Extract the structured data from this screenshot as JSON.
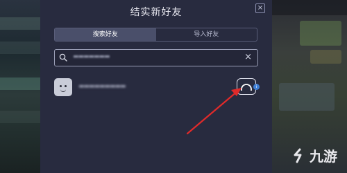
{
  "dialog": {
    "title": "结实新好友",
    "close_symbol": "×"
  },
  "tabs": [
    {
      "label": "搜索好友",
      "active": true
    },
    {
      "label": "导入好友",
      "active": false
    }
  ],
  "search": {
    "value": "▬▬▬▬▬▬▬",
    "clear_symbol": "×"
  },
  "result": {
    "name": "▬▬▬▬▬▬▬▬▬"
  },
  "annotation": {
    "arrow_color": "#e02a2a"
  },
  "watermark": {
    "text": "九游"
  },
  "icons": [
    "close-icon",
    "search-icon",
    "clear-icon",
    "avatar-face",
    "add-friend-icon",
    "badge-icon",
    "jiuyou-logo-icon"
  ]
}
